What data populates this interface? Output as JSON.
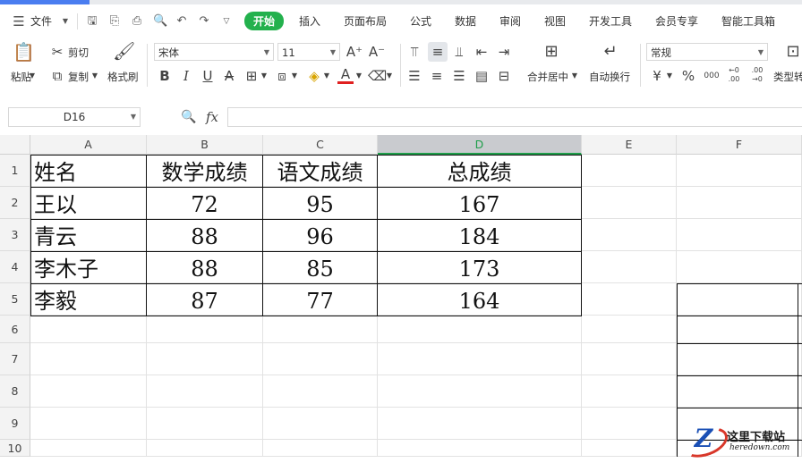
{
  "menu": {
    "file_label": "文件",
    "tabs": [
      "开始",
      "插入",
      "页面布局",
      "公式",
      "数据",
      "审阅",
      "视图",
      "开发工具",
      "会员专享",
      "智能工具箱"
    ],
    "active_tab": "开始"
  },
  "toolbar": {
    "paste_label": "粘贴",
    "cut_label": "剪切",
    "copy_label": "复制",
    "format_painter_label": "格式刷",
    "font_name": "宋体",
    "font_size": "11",
    "merge_label": "合并居中",
    "wrap_label": "自动换行",
    "number_format": "常规",
    "type_convert_label": "类型转",
    "currency_symbol": "¥",
    "percent_symbol": "%",
    "thousands_symbol": "000",
    "inc_decimal": "←0 .00",
    "dec_decimal": ".00 →0",
    "bold": "B",
    "italic": "I",
    "underline": "U",
    "strike": "A",
    "font_color_glyph": "A",
    "grow_font": "A⁺",
    "shrink_font": "A⁻"
  },
  "formula_bar": {
    "cell_ref": "D16",
    "fx_label": "fx",
    "value": ""
  },
  "sheet": {
    "columns": [
      "A",
      "B",
      "C",
      "D",
      "E",
      "F"
    ],
    "selected_column": "D",
    "rows": [
      "1",
      "2",
      "3",
      "4",
      "5",
      "6",
      "7",
      "8",
      "9",
      "10"
    ],
    "table": [
      [
        "姓名",
        "数学成绩",
        "语文成绩",
        "总成绩"
      ],
      [
        "王以",
        "72",
        "95",
        "167"
      ],
      [
        "青云",
        "88",
        "96",
        "184"
      ],
      [
        "李木子",
        "88",
        "85",
        "173"
      ],
      [
        "李毅",
        "87",
        "77",
        "164"
      ]
    ]
  },
  "watermark": {
    "logo_letter": "Z",
    "title": "这里下载站",
    "subtitle": "heredown.com"
  }
}
